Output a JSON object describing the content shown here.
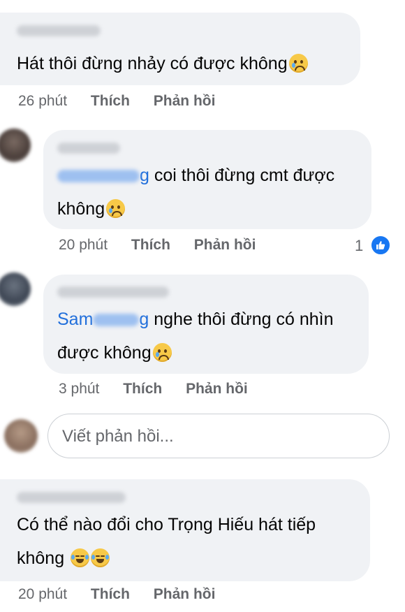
{
  "comments": [
    {
      "text": "Hát thôi đừng nhảy có được không",
      "emoji": "crying-face",
      "time": "26 phút",
      "like_label": "Thích",
      "reply_label": "Phản hồi"
    },
    {
      "mention_tail": "g",
      "line1": "coi thôi đừng cmt được",
      "line2": "không",
      "emoji": "crying-face",
      "time": "20 phút",
      "like_label": "Thích",
      "reply_label": "Phản hồi",
      "reaction_count": "1",
      "reaction_icon": "like-icon"
    },
    {
      "mention_head": "Sam",
      "mention_tail": "g",
      "line1": "nghe thôi đừng có nhìn",
      "line2": "được không",
      "emoji": "crying-face",
      "time": "3 phút",
      "like_label": "Thích",
      "reply_label": "Phản hồi"
    },
    {
      "line1": "Có thể nào đổi cho Trọng Hiếu hát tiếp",
      "line2": "không",
      "emoji": "face-with-tears-of-joy",
      "time": "20 phút",
      "like_label": "Thích",
      "reply_label": "Phản hồi"
    }
  ],
  "reply_input": {
    "placeholder": "Viết phản hồi..."
  },
  "colors": {
    "bubble": "#f0f2f5",
    "meta": "#65676b",
    "accent": "#1877f2"
  }
}
